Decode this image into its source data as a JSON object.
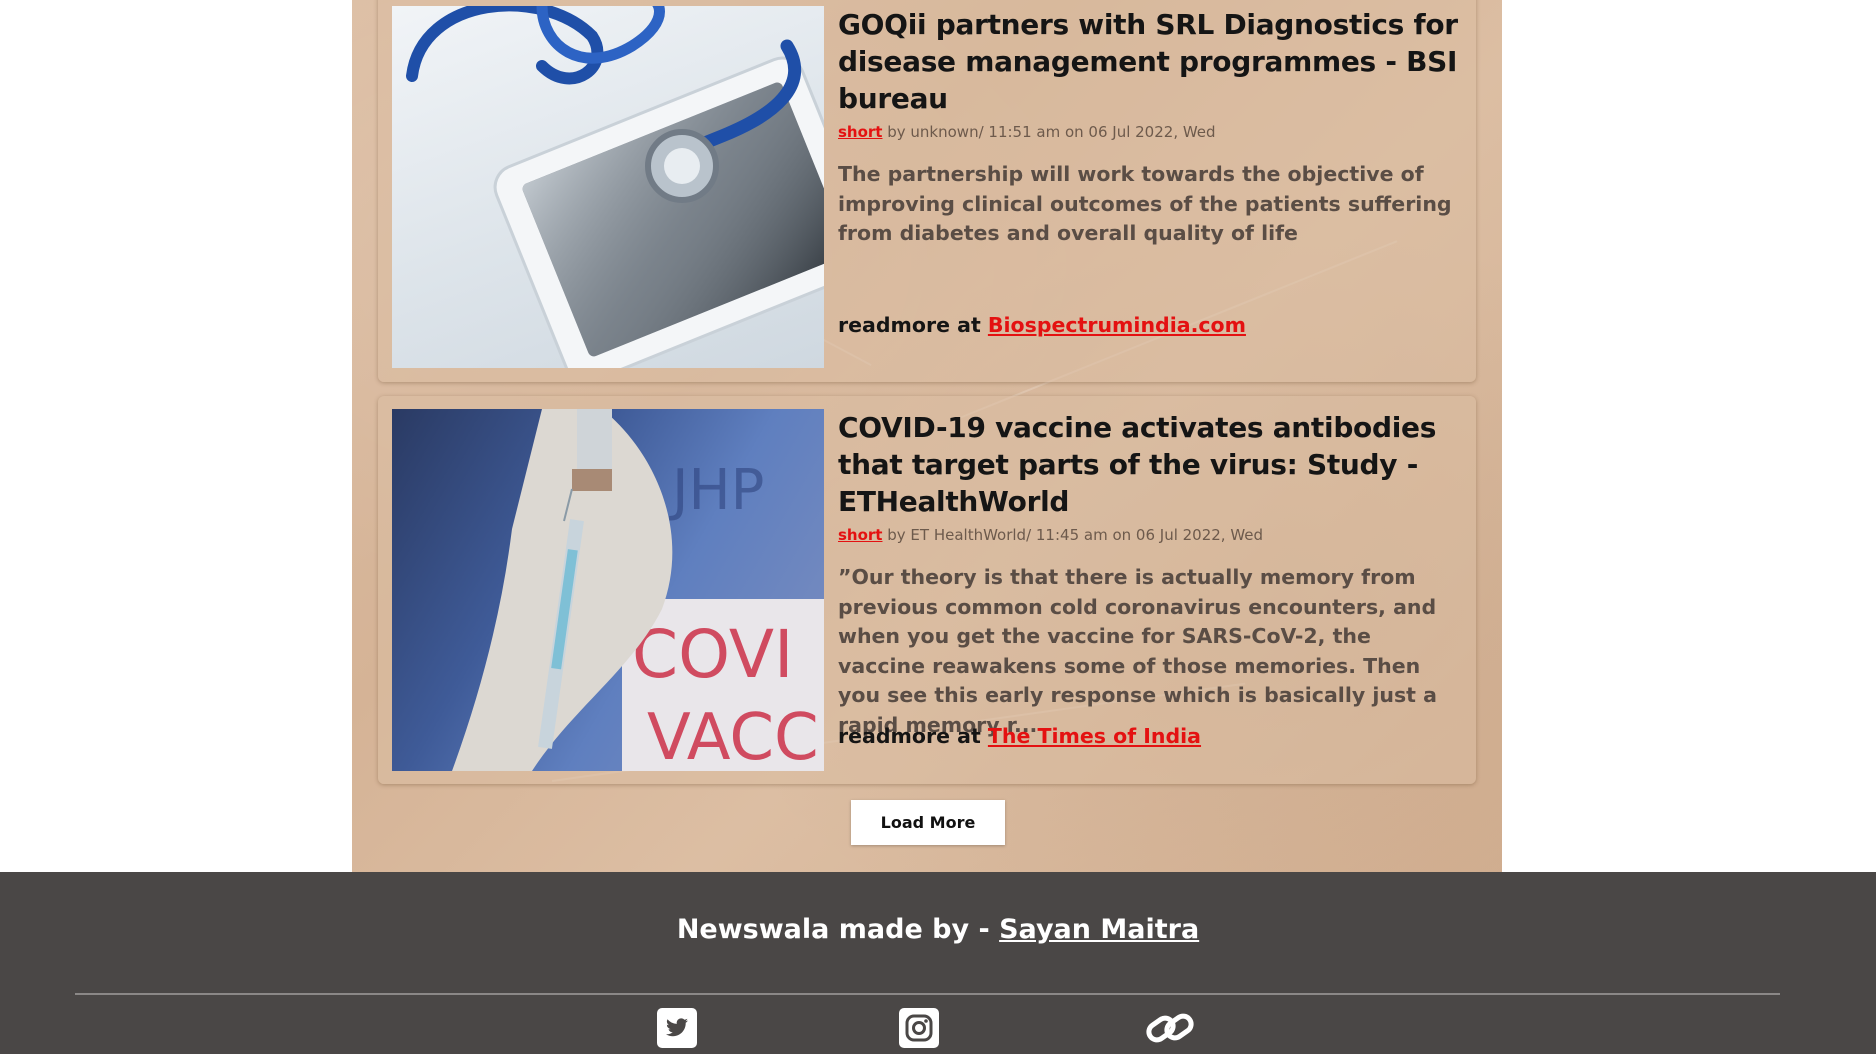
{
  "articles": [
    {
      "headline": "GOQii partners with SRL Diagnostics for disease management programmes - BSI bureau",
      "tag": "short",
      "meta": " by unknown/ 11:51 am on 06 Jul 2022, Wed",
      "summary": "The partnership will work towards the objective of improving clinical outcomes of the patients suffering from diabetes and overall quality of life",
      "readmore_prefix": "readmore at ",
      "source_name": "Biospectrumindia.com",
      "image_icon": "stethoscope-tablet-image"
    },
    {
      "headline": "COVID-19 vaccine activates antibodies that target parts of the virus: Study - ETHealthWorld",
      "tag": "short",
      "meta": " by ET HealthWorld/ 11:45 am on 06 Jul 2022, Wed",
      "summary": "”Our theory is that there is actually memory from previous common cold coronavirus encounters, and when you get the vaccine for SARS-CoV-2, the vaccine reawakens some of those memories. Then you see this early response which is basically just a rapid memory r...",
      "readmore_prefix": "readmore at ",
      "source_name": "The Times of India",
      "image_icon": "covid-vaccine-syringe-image"
    }
  ],
  "load_more_label": "Load More",
  "footer": {
    "credit_prefix": "Newswala made by - ",
    "author_name": "Sayan Maitra",
    "icons": [
      "twitter-icon",
      "instagram-icon",
      "link-icon"
    ]
  },
  "colors": {
    "accent_red": "#e41111",
    "footer_bg": "#4a4746",
    "paper_bg": "#d8b99d"
  }
}
